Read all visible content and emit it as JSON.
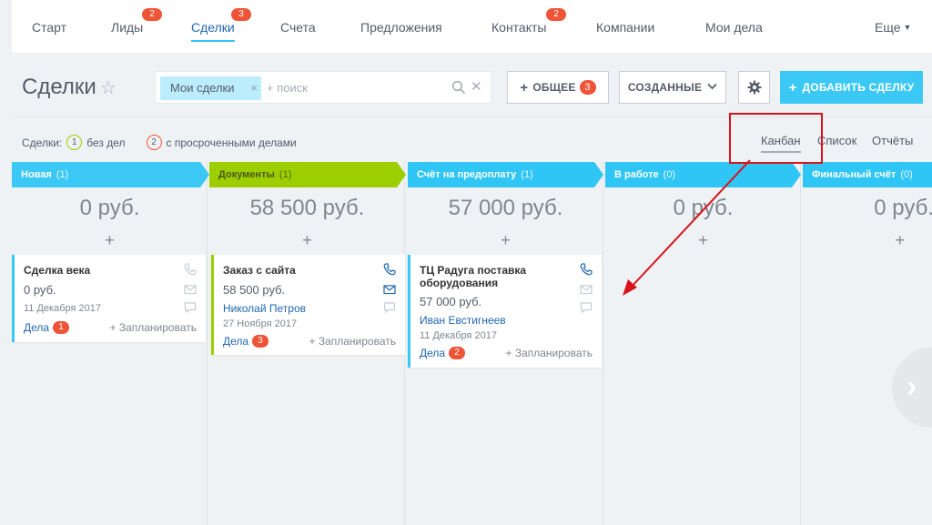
{
  "nav": {
    "items": [
      {
        "label": "Старт",
        "badge": ""
      },
      {
        "label": "Лиды",
        "badge": "2"
      },
      {
        "label": "Сделки",
        "badge": "3"
      },
      {
        "label": "Счета",
        "badge": ""
      },
      {
        "label": "Предложения",
        "badge": ""
      },
      {
        "label": "Контакты",
        "badge": "2"
      },
      {
        "label": "Компании",
        "badge": ""
      },
      {
        "label": "Мои дела",
        "badge": ""
      }
    ],
    "more": "Еще",
    "active": "Сделки"
  },
  "header": {
    "title": "Сделки",
    "filter_chip": "Мои сделки",
    "search_placeholder": "+ поиск",
    "general_label": "ОБЩЕЕ",
    "general_badge": "3",
    "created_label": "СОЗДАННЫЕ",
    "add_label": "ДОБАВИТЬ СДЕЛКУ"
  },
  "stats": {
    "prefix": "Сделки:",
    "no_tasks_count": "1",
    "no_tasks_label": "без дел",
    "overdue_count": "2",
    "overdue_label": "с просроченными делами"
  },
  "views": {
    "kanban": "Канбан",
    "list": "Список",
    "reports": "Отчёты"
  },
  "columns": [
    {
      "name": "Новая",
      "count": "(1)",
      "total": "0 руб.",
      "color": "#3bc8f5"
    },
    {
      "name": "Документы",
      "count": "(1)",
      "total": "58 500 руб.",
      "color": "#9dcf00"
    },
    {
      "name": "Счёт на предоплату",
      "count": "(1)",
      "total": "57 000 руб.",
      "color": "#2fc6f6"
    },
    {
      "name": "В работе",
      "count": "(0)",
      "total": "0 руб.",
      "color": "#2fc6f6"
    },
    {
      "name": "Финальный счёт",
      "count": "(0)",
      "total": "0 руб.",
      "color": "#2fc6f6"
    }
  ],
  "cards": [
    {
      "title": "Сделка века",
      "sum": "0 руб.",
      "person": "",
      "date": "11 Декабря 2017",
      "deals_label": "Дела",
      "deals_count": "1",
      "plan": "+ Запланировать"
    },
    {
      "title": "Заказ с сайта",
      "sum": "58 500 руб.",
      "person": "Николай Петров",
      "date": "27 Ноября 2017",
      "deals_label": "Дела",
      "deals_count": "3",
      "plan": "+ Запланировать"
    },
    {
      "title": "ТЦ Радуга поставка оборудования",
      "sum": "57 000 руб.",
      "person": "Иван Евстигнеев",
      "date": "11 Декабря 2017",
      "deals_label": "Дела",
      "deals_count": "2",
      "plan": "+ Запланировать"
    }
  ],
  "colors": {
    "accent": "#2fc6f6",
    "badge": "#ef5436",
    "green": "#9dcf00",
    "annotation": "#d9121b"
  },
  "icons": [
    "star-icon",
    "search-icon",
    "close-icon",
    "gear-icon",
    "phone-icon",
    "mail-icon",
    "chat-icon",
    "chevron-right-icon"
  ]
}
